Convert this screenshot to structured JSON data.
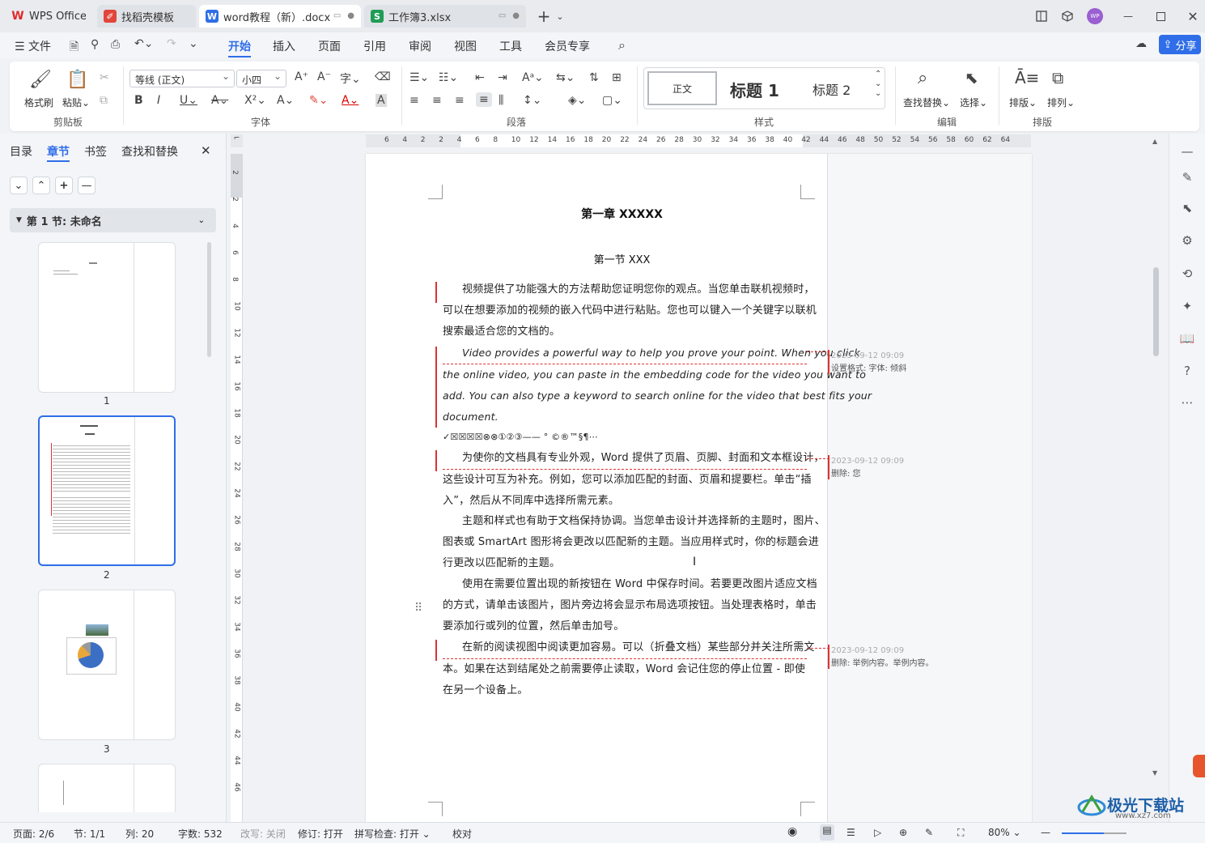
{
  "tabs": [
    {
      "label": "WPS Office",
      "icon": "wps-logo"
    },
    {
      "label": "找稻壳模板",
      "icon": "docer-icon"
    },
    {
      "label": "word教程（新）.docx",
      "icon": "word-doc-icon"
    },
    {
      "label": "工作簿3.xlsx",
      "icon": "spreadsheet-icon"
    }
  ],
  "title_icons": {
    "w": "W",
    "s": "S",
    "avatar": "WP"
  },
  "menu": {
    "file": "文件",
    "items": [
      "开始",
      "插入",
      "页面",
      "引用",
      "审阅",
      "视图",
      "工具",
      "会员专享"
    ],
    "active": "开始",
    "share": "分享"
  },
  "ribbon": {
    "clipboard": {
      "format_painter": "格式刷",
      "paste": "粘贴",
      "group": "剪贴板"
    },
    "font": {
      "name": "等线 (正文)",
      "size": "小四",
      "group": "字体"
    },
    "paragraph": {
      "group": "段落"
    },
    "styles": {
      "normal": "正文",
      "h1": "标题  1",
      "h2": "标题  2",
      "group": "样式"
    },
    "edit": {
      "find_replace": "查找替换",
      "select": "选择",
      "group": "编辑"
    },
    "arrange": {
      "layout": "排版",
      "order": "排列",
      "group": "排版"
    }
  },
  "panel": {
    "tabs": [
      "目录",
      "章节",
      "书签",
      "查找和替换"
    ],
    "active": "章节",
    "section": "第 1 节: 未命名",
    "pages": [
      "1",
      "2",
      "3"
    ]
  },
  "hruler": [
    "6",
    "4",
    "2",
    "2",
    "4",
    "6",
    "8",
    "10",
    "12",
    "14",
    "16",
    "18",
    "20",
    "22",
    "24",
    "26",
    "28",
    "30",
    "32",
    "34",
    "36",
    "38",
    "40",
    "42",
    "44",
    "46",
    "48",
    "50",
    "52",
    "54",
    "56",
    "58",
    "60",
    "62",
    "64"
  ],
  "vruler": [
    "2",
    "2",
    "4",
    "6",
    "8",
    "10",
    "12",
    "14",
    "16",
    "18",
    "20",
    "22",
    "24",
    "26",
    "28",
    "30",
    "32",
    "34",
    "36",
    "38",
    "40",
    "42",
    "44",
    "46"
  ],
  "doc": {
    "chapter": "第一章  XXXXX",
    "section": "第一节  XXX",
    "p1": [
      "视频提供了功能强大的方法帮助您证明您你的观点。当您单击联机视频时，",
      "可以在想要添加的视频的嵌入代码中进行粘贴。您也可以键入一个关键字以联机",
      "搜索最适合您的文档的。"
    ],
    "p2": [
      "Video provides a powerful way to help you prove your point. When you click",
      "the online video, you can paste in the embedding code for the video you want to",
      "add. You can also type a keyword to search online for the video that best fits your",
      "document."
    ],
    "symbols": "✓☒☒☒☒⊗⊗①②③——    °  ©®™§¶⋯",
    "p3": [
      "为使你的文档具有专业外观，Word  提供了页眉、页脚、封面和文本框设计，",
      "这些设计可互为补充。例如，您可以添加匹配的封面、页眉和提要栏。单击“插",
      "入”，然后从不同库中选择所需元素。"
    ],
    "p4": [
      "主题和样式也有助于文档保持协调。当您单击设计并选择新的主题时，图片、",
      "图表或  SmartArt  图形将会更改以匹配新的主题。当应用样式时，你的标题会进",
      "行更改以匹配新的主题。"
    ],
    "p5": [
      "使用在需要位置出现的新按钮在  Word  中保存时间。若要更改图片适应文档",
      "的方式，请单击该图片，图片旁边将会显示布局选项按钮。当处理表格时，单击",
      "要添加行或列的位置，然后单击加号。"
    ],
    "p6": [
      "在新的阅读视图中阅读更加容易。可以（折叠文档）某些部分并关注所需文",
      "本。如果在达到结尾处之前需要停止读取，Word  会记住您的停止位置  -  即使",
      "在另一个设备上。"
    ]
  },
  "comments": [
    {
      "date": "2023-09-12 09:09",
      "text": "设置格式: 字体: 倾斜"
    },
    {
      "date": "2023-09-12 09:09",
      "text": "删除: 您"
    },
    {
      "date": "2023-09-12 09:09",
      "text": "删除: 举例内容。举例内容。"
    }
  ],
  "status": {
    "page": "页面: 2/6",
    "section": "节: 1/1",
    "col": "列: 20",
    "words": "字数: 532",
    "overtype": "改写: 关闭",
    "revision": "修订: 打开",
    "spell": "拼写检查: 打开",
    "proof": "校对",
    "zoom": "80%"
  },
  "watermark": {
    "text": "极光下载站",
    "url": "www.xz7.com"
  }
}
